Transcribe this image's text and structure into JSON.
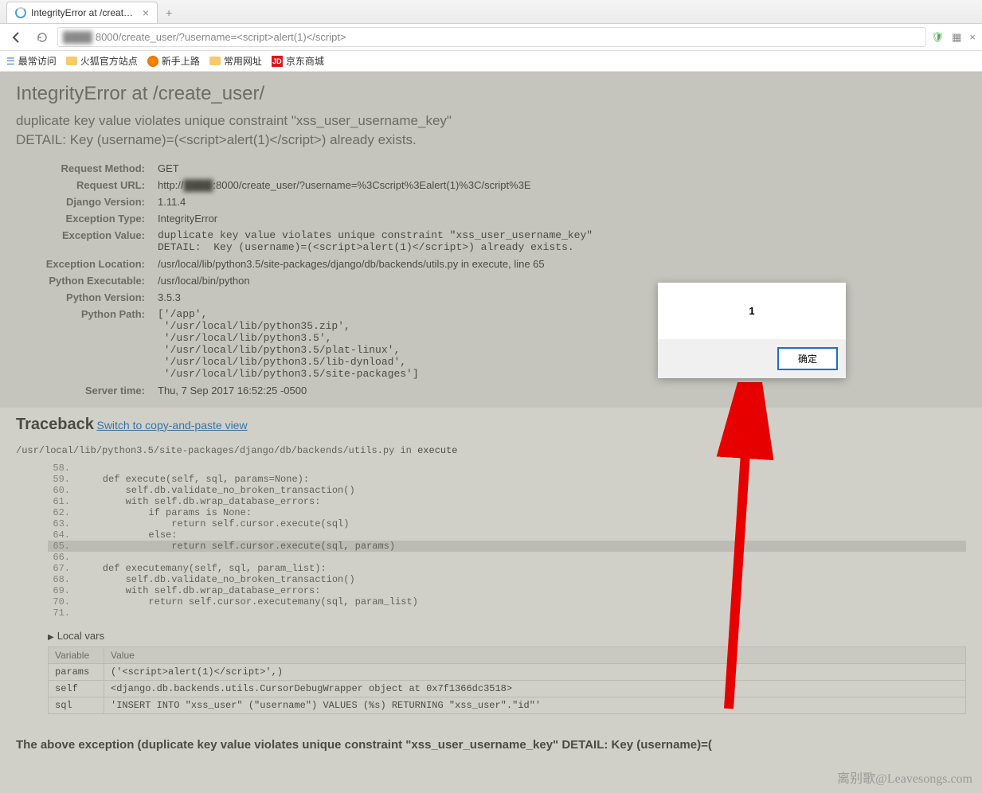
{
  "browser": {
    "tab_title": "IntegrityError at /create_u",
    "url_prefix_blur": "████",
    "url_visible": "8000/create_user/?username=<script>alert(1)</script>",
    "new_tab": "+",
    "bookmarks": [
      {
        "label": "最常访问",
        "icon": "list"
      },
      {
        "label": "火狐官方站点",
        "icon": "folder"
      },
      {
        "label": "新手上路",
        "icon": "firefox"
      },
      {
        "label": "常用网址",
        "icon": "folder"
      },
      {
        "label": "京东商城",
        "icon": "jd"
      }
    ]
  },
  "error": {
    "title": "IntegrityError at /create_user/",
    "summary": "duplicate key value violates unique constraint \"xss_user_username_key\"\nDETAIL:  Key (username)=(<script>alert(1)</script>) already exists.",
    "meta": {
      "request_method_label": "Request Method:",
      "request_method": "GET",
      "request_url_label": "Request URL:",
      "request_url_prefix": "http://",
      "request_url_blur": "████",
      "request_url_rest": ":8000/create_user/?username=%3Cscript%3Ealert(1)%3C/script%3E",
      "django_version_label": "Django Version:",
      "django_version": "1.11.4",
      "exception_type_label": "Exception Type:",
      "exception_type": "IntegrityError",
      "exception_value_label": "Exception Value:",
      "exception_value": "duplicate key value violates unique constraint \"xss_user_username_key\"\nDETAIL:  Key (username)=(<script>alert(1)</script>) already exists.",
      "exception_location_label": "Exception Location:",
      "exception_location": "/usr/local/lib/python3.5/site-packages/django/db/backends/utils.py in execute, line 65",
      "python_exe_label": "Python Executable:",
      "python_exe": "/usr/local/bin/python",
      "python_version_label": "Python Version:",
      "python_version": "3.5.3",
      "python_path_label": "Python Path:",
      "python_path": "['/app',\n '/usr/local/lib/python35.zip',\n '/usr/local/lib/python3.5',\n '/usr/local/lib/python3.5/plat-linux',\n '/usr/local/lib/python3.5/lib-dynload',\n '/usr/local/lib/python3.5/site-packages']",
      "server_time_label": "Server time:",
      "server_time": "Thu, 7 Sep 2017 16:52:25 -0500"
    }
  },
  "traceback": {
    "heading": "Traceback",
    "switch_link": "Switch to copy-and-paste view",
    "file": "/usr/local/lib/python3.5/site-packages/django/db/backends/utils.py",
    "in_word": " in ",
    "func": "execute",
    "code": [
      {
        "n": "58.",
        "t": ""
      },
      {
        "n": "59.",
        "t": "    def execute(self, sql, params=None):"
      },
      {
        "n": "60.",
        "t": "        self.db.validate_no_broken_transaction()"
      },
      {
        "n": "61.",
        "t": "        with self.db.wrap_database_errors:"
      },
      {
        "n": "62.",
        "t": "            if params is None:"
      },
      {
        "n": "63.",
        "t": "                return self.cursor.execute(sql)"
      },
      {
        "n": "64.",
        "t": "            else:"
      },
      {
        "n": "65.",
        "t": "                return self.cursor.execute(sql, params)",
        "hl": true
      },
      {
        "n": "66.",
        "t": ""
      },
      {
        "n": "67.",
        "t": "    def executemany(self, sql, param_list):"
      },
      {
        "n": "68.",
        "t": "        self.db.validate_no_broken_transaction()"
      },
      {
        "n": "69.",
        "t": "        with self.db.wrap_database_errors:"
      },
      {
        "n": "70.",
        "t": "            return self.cursor.executemany(sql, param_list)"
      },
      {
        "n": "71.",
        "t": ""
      }
    ],
    "local_vars_label": "Local vars",
    "vars_header": {
      "variable": "Variable",
      "value": "Value"
    },
    "vars": [
      {
        "k": "params",
        "v": "('<script>alert(1)</script>',)"
      },
      {
        "k": "self",
        "v": "<django.db.backends.utils.CursorDebugWrapper object at 0x7f1366dc3518>"
      },
      {
        "k": "sql",
        "v": "'INSERT INTO \"xss_user\" (\"username\") VALUES (%s) RETURNING \"xss_user\".\"id\"'"
      }
    ]
  },
  "chain_text": "The above exception (duplicate key value violates unique constraint \"xss_user_username_key\" DETAIL: Key (username)=(",
  "alert": {
    "message": "1",
    "ok": "确定"
  },
  "watermark": "离别歌@Leavesongs.com"
}
